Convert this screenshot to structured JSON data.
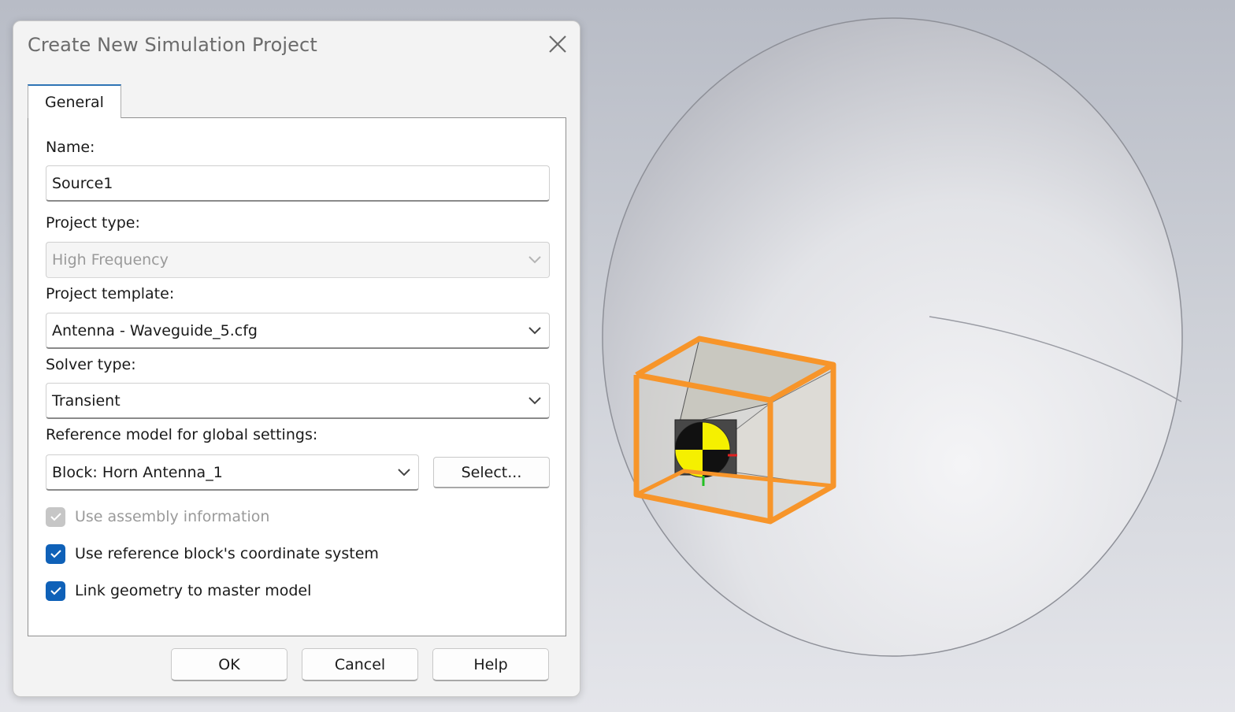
{
  "dialog": {
    "title": "Create New Simulation Project",
    "tab_general": "General",
    "name_label": "Name:",
    "name_value": "Source1",
    "project_type_label": "Project type:",
    "project_type_value": "High Frequency",
    "project_template_label": "Project template:",
    "project_template_value": "Antenna - Waveguide_5.cfg",
    "solver_type_label": "Solver type:",
    "solver_type_value": "Transient",
    "reference_model_label": "Reference model for global settings:",
    "reference_model_value": "Block: Horn Antenna_1",
    "select_button": "Select...",
    "checkboxes": [
      {
        "label": "Use assembly information",
        "checked": true,
        "enabled": false
      },
      {
        "label": "Use reference block's coordinate system",
        "checked": true,
        "enabled": true
      },
      {
        "label": "Link geometry to master model",
        "checked": true,
        "enabled": true
      }
    ],
    "ok_button": "OK",
    "cancel_button": "Cancel",
    "help_button": "Help"
  },
  "icons": {
    "close": "close-icon",
    "dropdown": "chevron-down-icon",
    "check": "check-icon"
  },
  "colors": {
    "accent": "#0f61b8",
    "tab_accent": "#2e74b5",
    "bounding_box": "#f7952a",
    "marker_yellow": "#f5f000"
  }
}
